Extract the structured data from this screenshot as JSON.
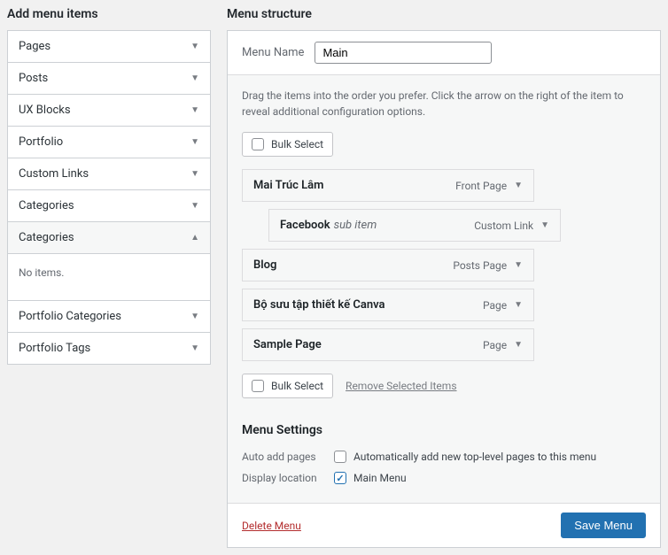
{
  "left": {
    "heading": "Add menu items",
    "panels": [
      {
        "label": "Pages",
        "open": false
      },
      {
        "label": "Posts",
        "open": false
      },
      {
        "label": "UX Blocks",
        "open": false
      },
      {
        "label": "Portfolio",
        "open": false
      },
      {
        "label": "Custom Links",
        "open": false
      },
      {
        "label": "Categories",
        "open": false
      },
      {
        "label": "Categories",
        "open": true,
        "body": "No items."
      },
      {
        "label": "Portfolio Categories",
        "open": false
      },
      {
        "label": "Portfolio Tags",
        "open": false
      }
    ]
  },
  "right": {
    "heading": "Menu structure",
    "name_label": "Menu Name",
    "name_value": "Main",
    "instructions": "Drag the items into the order you prefer. Click the arrow on the right of the item to reveal additional configuration options.",
    "bulk_label": "Bulk Select",
    "remove_label": "Remove Selected Items",
    "items": [
      {
        "title": "Mai Trúc Lâm",
        "type": "Front Page",
        "sub": false
      },
      {
        "title": "Facebook",
        "type": "Custom Link",
        "sub": true,
        "subtag": "sub item"
      },
      {
        "title": "Blog",
        "type": "Posts Page",
        "sub": false
      },
      {
        "title": "Bộ sưu tập thiết kế Canva",
        "type": "Page",
        "sub": false
      },
      {
        "title": "Sample Page",
        "type": "Page",
        "sub": false
      }
    ],
    "settings_heading": "Menu Settings",
    "auto_add_label": "Auto add pages",
    "auto_add_text": "Automatically add new top-level pages to this menu",
    "display_label": "Display location",
    "display_text": "Main Menu",
    "delete_label": "Delete Menu",
    "save_label": "Save Menu"
  }
}
